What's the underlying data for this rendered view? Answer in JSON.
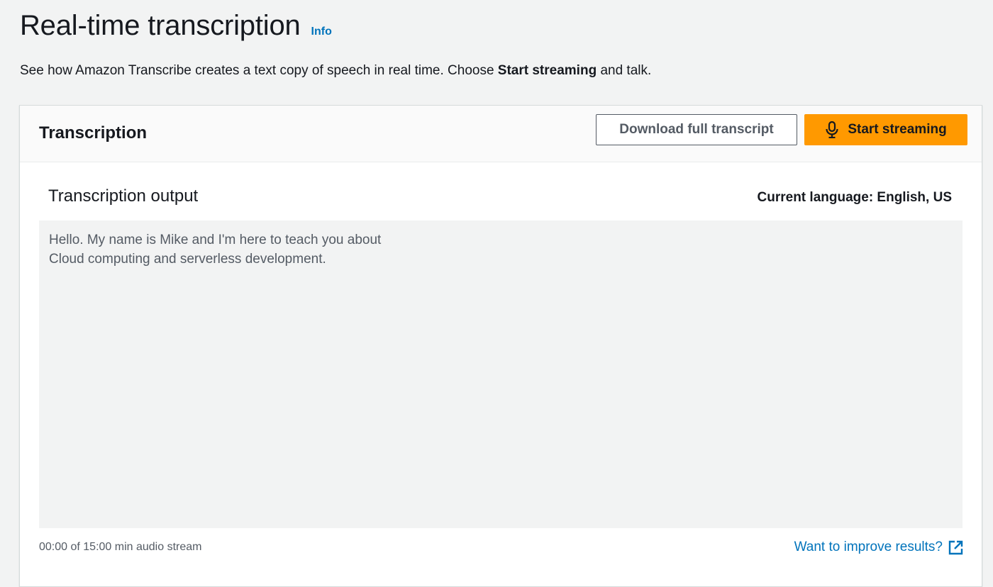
{
  "page": {
    "title": "Real-time transcription",
    "info_link": "Info",
    "description_pre": "See how Amazon Transcribe creates a text copy of speech in real time. Choose ",
    "description_bold": "Start streaming",
    "description_post": " and talk."
  },
  "container": {
    "title": "Transcription",
    "download_button": "Download full transcript",
    "start_button": "Start streaming",
    "start_button_icon": "microphone-icon"
  },
  "output": {
    "heading": "Transcription output",
    "language": "Current language: English, US",
    "lines": [
      "Hello. My name is Mike and I'm here to teach you about",
      "Cloud computing and serverless development."
    ]
  },
  "footer": {
    "status": "00:00 of 15:00 min audio stream",
    "improve_link": "Want to improve results?",
    "improve_icon": "external-link-icon"
  },
  "colors": {
    "accent": "#ff9900",
    "link": "#0073bb",
    "background": "#f2f3f3"
  }
}
